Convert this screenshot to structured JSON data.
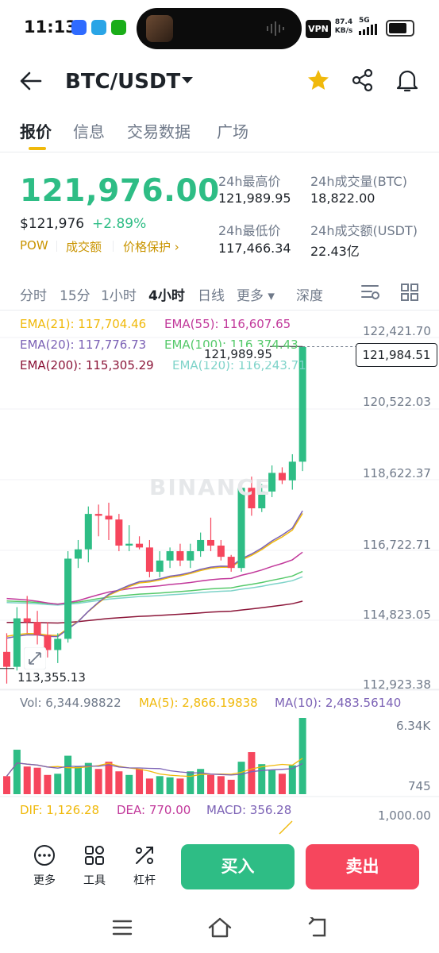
{
  "status_bar": {
    "time": "11:13",
    "vpn": "VPN",
    "net_speed_value": "87.4",
    "net_speed_unit": "KB/s",
    "signal": "5G"
  },
  "header": {
    "pair": "BTC/USDT",
    "back_icon": "arrow-left-icon",
    "favorite_icon": "star-icon",
    "share_icon": "share-icon",
    "alert_icon": "bell-icon"
  },
  "tabs": [
    {
      "label": "报价",
      "active": true
    },
    {
      "label": "信息",
      "active": false
    },
    {
      "label": "交易数据",
      "active": false
    },
    {
      "label": "广场",
      "active": false
    }
  ],
  "price": {
    "last": "121,976.00",
    "usd": "$121,976",
    "change": "+2.89%",
    "tags": [
      "POW",
      "成交额",
      "价格保护 ›"
    ]
  },
  "stats": {
    "high_label": "24h最高价",
    "high_value": "121,989.95",
    "low_label": "24h最低价",
    "low_value": "117,466.34",
    "vol_btc_label": "24h成交量(BTC)",
    "vol_btc_value": "18,822.00",
    "vol_usdt_label": "24h成交额(USDT)",
    "vol_usdt_value": "22.43亿"
  },
  "intervals": [
    {
      "label": "分时",
      "active": false
    },
    {
      "label": "15分",
      "active": false
    },
    {
      "label": "1小时",
      "active": false
    },
    {
      "label": "4小时",
      "active": true
    },
    {
      "label": "日线",
      "active": false
    },
    {
      "label": "更多 ▾",
      "active": false
    },
    {
      "label": "深度",
      "active": false
    }
  ],
  "ema": {
    "ema21": "EMA(21): 117,704.46",
    "ema55": "EMA(55): 116,607.65",
    "ema20": "EMA(20): 117,776.73",
    "ema100": "EMA(100): 116,374.43",
    "ema200": "EMA(200): 115,305.29",
    "ema120": "EMA(120): 116,243.71"
  },
  "colors": {
    "up": "#2ebd85",
    "down": "#f6465d",
    "ema21": "#f0b90b",
    "ema55": "#c2399b",
    "ema20": "#7b61b5",
    "ema100": "#55c96a",
    "ema200": "#8b1538",
    "ema120": "#7ed3c9",
    "accent": "#f0b90b"
  },
  "price_axis": [
    "122,421.70",
    "120,522.03",
    "118,622.37",
    "116,722.71",
    "114,823.05",
    "112,923.38"
  ],
  "chart_high_marker": "121,989.95",
  "chart_low_marker": "113,355.13",
  "crosshair_price": "121,984.51",
  "watermark": "BINANCE",
  "volume": {
    "vol": "Vol: 6,344.98822",
    "ma5": "MA(5): 2,866.19838",
    "ma10": "MA(10): 2,483.56140",
    "axis_top": "6.34K",
    "axis_bottom": "745"
  },
  "macd": {
    "dif": "DIF: 1,126.28",
    "dea": "DEA: 770.00",
    "macd": "MACD: 356.28",
    "axis": "1,000.00"
  },
  "chart_data": {
    "type": "candlestick",
    "interval": "4小时",
    "ylim": [
      112923.38,
      122421.7
    ],
    "candles": [
      {
        "o": 113800,
        "h": 114300,
        "l": 112950,
        "c": 113400
      },
      {
        "o": 113400,
        "h": 115000,
        "l": 113300,
        "c": 114700
      },
      {
        "o": 114700,
        "h": 115300,
        "l": 114300,
        "c": 114600
      },
      {
        "o": 114600,
        "h": 114900,
        "l": 114000,
        "c": 114250
      },
      {
        "o": 114250,
        "h": 114600,
        "l": 113650,
        "c": 113850
      },
      {
        "o": 113850,
        "h": 114300,
        "l": 113500,
        "c": 114150
      },
      {
        "o": 114150,
        "h": 116500,
        "l": 114050,
        "c": 116300
      },
      {
        "o": 116300,
        "h": 116800,
        "l": 116050,
        "c": 116550
      },
      {
        "o": 116550,
        "h": 117700,
        "l": 116200,
        "c": 117500
      },
      {
        "o": 117500,
        "h": 117750,
        "l": 116900,
        "c": 117450
      },
      {
        "o": 117450,
        "h": 117800,
        "l": 116800,
        "c": 117350
      },
      {
        "o": 117350,
        "h": 117500,
        "l": 116500,
        "c": 116650
      },
      {
        "o": 116650,
        "h": 117200,
        "l": 116500,
        "c": 116700
      },
      {
        "o": 116700,
        "h": 116900,
        "l": 116550,
        "c": 116600
      },
      {
        "o": 116600,
        "h": 116800,
        "l": 115800,
        "c": 115950
      },
      {
        "o": 115950,
        "h": 116500,
        "l": 115800,
        "c": 116250
      },
      {
        "o": 116250,
        "h": 116600,
        "l": 116050,
        "c": 116500
      },
      {
        "o": 116500,
        "h": 116700,
        "l": 116100,
        "c": 116250
      },
      {
        "o": 116250,
        "h": 116700,
        "l": 116050,
        "c": 116500
      },
      {
        "o": 116500,
        "h": 117000,
        "l": 116350,
        "c": 116800
      },
      {
        "o": 116800,
        "h": 117400,
        "l": 116500,
        "c": 116650
      },
      {
        "o": 116650,
        "h": 116800,
        "l": 116250,
        "c": 116350
      },
      {
        "o": 116350,
        "h": 116400,
        "l": 115950,
        "c": 116050
      },
      {
        "o": 116050,
        "h": 118300,
        "l": 115950,
        "c": 118200
      },
      {
        "o": 118200,
        "h": 118500,
        "l": 117450,
        "c": 117650
      },
      {
        "o": 117650,
        "h": 118300,
        "l": 117550,
        "c": 118100
      },
      {
        "o": 118100,
        "h": 118800,
        "l": 117950,
        "c": 118600
      },
      {
        "o": 118600,
        "h": 118750,
        "l": 118300,
        "c": 118400
      },
      {
        "o": 118400,
        "h": 119100,
        "l": 118150,
        "c": 118900
      },
      {
        "o": 118900,
        "h": 121989.95,
        "l": 118650,
        "c": 121976
      }
    ],
    "volumes": [
      1500,
      3700,
      2300,
      2200,
      1600,
      1700,
      3200,
      2300,
      2600,
      2100,
      2700,
      1900,
      1600,
      2100,
      1300,
      1500,
      1400,
      1300,
      1900,
      2100,
      1600,
      1500,
      1200,
      2700,
      3500,
      2500,
      2000,
      1700,
      2400,
      6344.98822
    ]
  },
  "bottom_bar": {
    "tools": [
      {
        "label": "更多",
        "icon": "more-dots-icon"
      },
      {
        "label": "工具",
        "icon": "grid-tools-icon"
      },
      {
        "label": "杠杆",
        "icon": "leverage-icon"
      }
    ],
    "buy": "买入",
    "sell": "卖出"
  }
}
